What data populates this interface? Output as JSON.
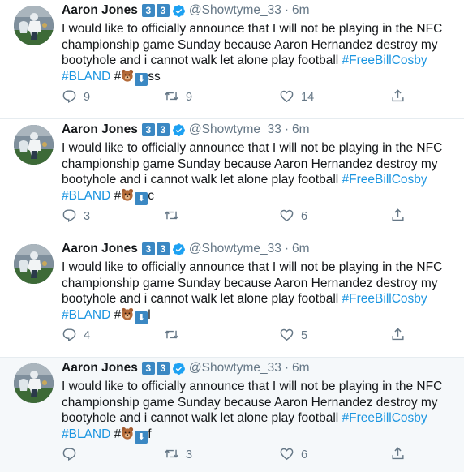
{
  "tweets": [
    {
      "name": "Aaron Jones",
      "badge1": "3",
      "badge2": "3",
      "handle": "@Showtyme_33",
      "dot": "·",
      "time": "6m",
      "text": "I would like to officially announce that I will not be playing in the NFC championship game Sunday because Aaron Hernandez destroy my bootyhole and i cannot walk let alone play football ",
      "hashtag1": "#FreeBillCosby",
      "hashtag2": "#BLAND",
      "hash": "#",
      "arrow": "⬇",
      "suffix": "ss",
      "reply_count": "9",
      "retweet_count": "9",
      "like_count": "14",
      "hover": false
    },
    {
      "name": "Aaron Jones",
      "badge1": "3",
      "badge2": "3",
      "handle": "@Showtyme_33",
      "dot": "·",
      "time": "6m",
      "text": "I would like to officially announce that I will not be playing in the NFC championship game Sunday because Aaron Hernandez destroy my bootyhole and i cannot walk let alone play football ",
      "hashtag1": "#FreeBillCosby",
      "hashtag2": "#BLAND",
      "hash": "#",
      "arrow": "⬇",
      "suffix": "c",
      "reply_count": "3",
      "retweet_count": "",
      "like_count": "6",
      "hover": false
    },
    {
      "name": "Aaron Jones",
      "badge1": "3",
      "badge2": "3",
      "handle": "@Showtyme_33",
      "dot": "·",
      "time": "6m",
      "text": "I would like to officially announce that I will not be playing in the NFC championship game Sunday because Aaron Hernandez destroy my bootyhole and i cannot walk let alone play football ",
      "hashtag1": "#FreeBillCosby",
      "hashtag2": "#BLAND",
      "hash": "#",
      "arrow": "⬇",
      "suffix": "l",
      "reply_count": "4",
      "retweet_count": "",
      "like_count": "5",
      "hover": false
    },
    {
      "name": "Aaron Jones",
      "badge1": "3",
      "badge2": "3",
      "handle": "@Showtyme_33",
      "dot": "·",
      "time": "6m",
      "text": "I would like to officially announce that I will not be playing in the NFC championship game Sunday because Aaron Hernandez destroy my bootyhole and i cannot walk let alone play football ",
      "hashtag1": "#FreeBillCosby",
      "hashtag2": "#BLAND",
      "hash": "#",
      "arrow": "⬇",
      "suffix": "f",
      "reply_count": "",
      "retweet_count": "3",
      "like_count": "6",
      "hover": true
    }
  ],
  "icons": {
    "reply": "reply-icon",
    "retweet": "retweet-icon",
    "like": "heart-icon",
    "share": "share-icon",
    "verified": "verified-badge-icon",
    "emoji": "bear-face-emoji",
    "arrow": "down-arrow-emoji"
  },
  "colors": {
    "link": "#1b95e0",
    "meta": "#657786",
    "badge": "#3b88c3",
    "hover_bg": "#f5f8fa",
    "divider": "#e6ecf0"
  }
}
